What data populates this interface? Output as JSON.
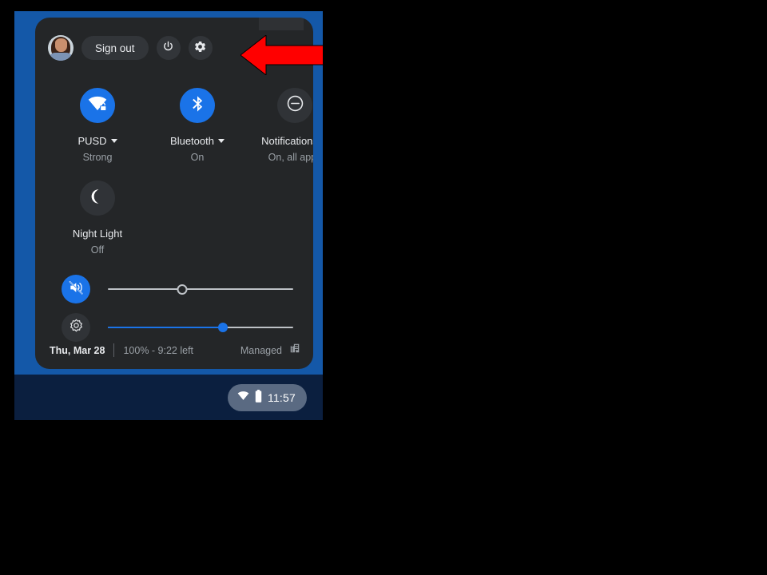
{
  "panel": {
    "header": {
      "avatar_name": "user-avatar",
      "sign_out_label": "Sign out",
      "power_icon": "power-icon",
      "settings_icon": "gear-icon"
    },
    "tiles": [
      {
        "icon": "wifi-locked-icon",
        "label": "PUSD",
        "status": "Strong",
        "state": "on",
        "has_caret": true
      },
      {
        "icon": "bluetooth-icon",
        "label": "Bluetooth",
        "status": "On",
        "state": "on",
        "has_caret": true
      },
      {
        "icon": "do-not-disturb-icon",
        "label": "Notifications",
        "status": "On, all apps",
        "state": "off",
        "has_caret": true
      },
      {
        "icon": "night-light-icon",
        "label": "Night Light",
        "status": "Off",
        "state": "off",
        "has_caret": false
      }
    ],
    "sliders": [
      {
        "name": "volume",
        "icon": "volume-muted-icon",
        "icon_state": "accent",
        "value": 40,
        "filled": false
      },
      {
        "name": "brightness",
        "icon": "brightness-icon",
        "icon_state": "neutral",
        "value": 62,
        "filled": true
      }
    ],
    "footer": {
      "date": "Thu, Mar 28",
      "battery": "100% - 9:22 left",
      "managed_label": "Managed",
      "managed_icon": "enterprise-building-icon"
    }
  },
  "shelf": {
    "wifi_icon": "wifi-icon",
    "battery_icon": "battery-full-icon",
    "time": "11:57"
  },
  "annotation": {
    "arrow_icon": "left-arrow-annotation",
    "color": "#FF0000"
  },
  "colors": {
    "accent": "#1A73E8",
    "panel_bg": "#242628",
    "wallpaper": "#1458A8",
    "shelf_bg": "#0B1F3F",
    "annotation_red": "#FF0000"
  }
}
